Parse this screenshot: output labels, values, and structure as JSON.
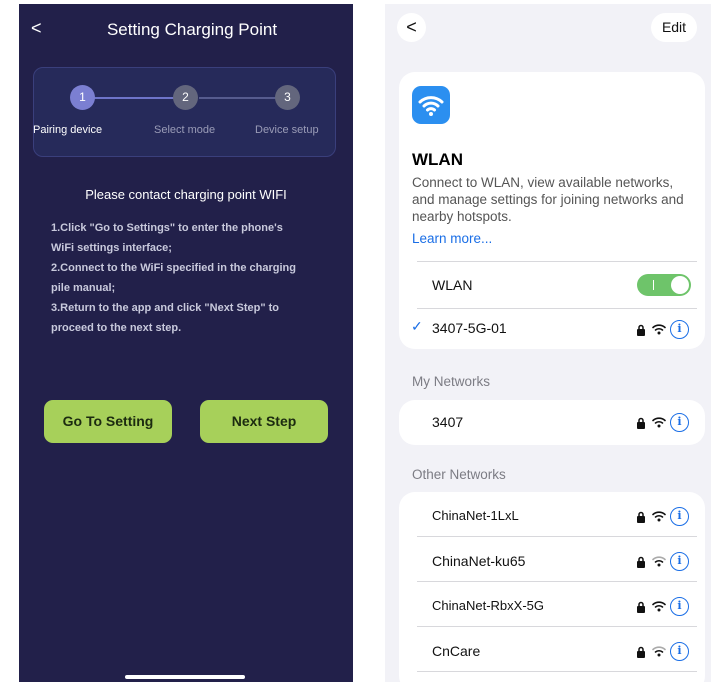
{
  "left": {
    "back_glyph": "<",
    "title": "Setting Charging Point",
    "steps": [
      {
        "number": "1",
        "label": "Pairing device"
      },
      {
        "number": "2",
        "label": "Select mode"
      },
      {
        "number": "3",
        "label": "Device setup"
      }
    ],
    "heading": "Please contact charging point WIFI",
    "instructions": [
      "1.Click \"Go to Settings\" to enter the phone's",
      "WiFi settings interface;",
      "2.Connect to the WiFi specified in the charging",
      "pile manual;",
      "3.Return to the app and click \"Next Step\" to",
      "proceed to the next step."
    ],
    "go_to_setting_label": "Go To Setting",
    "next_step_label": "Next Step",
    "colors": {
      "background": "#22204a",
      "button": "#a7d05a",
      "step_active": "#7b7fd2"
    }
  },
  "right": {
    "back_glyph": "<",
    "edit_label": "Edit",
    "wlan_icon": "wifi-app-icon",
    "wlan_title": "WLAN",
    "wlan_desc": "Connect to WLAN, view available networks, and manage settings for joining networks and nearby hotspots.",
    "learn_more": "Learn more...",
    "wlan_toggle_label": "WLAN",
    "wlan_toggle_on": true,
    "check_glyph": "✓",
    "connected_network": "3407-5G-01",
    "my_networks_title": "My Networks",
    "my_networks": [
      "3407"
    ],
    "other_networks_title": "Other Networks",
    "other_networks": [
      "ChinaNet-1LxL",
      "ChinaNet-ku65",
      "ChinaNet-RbxX-5G",
      "CnCare"
    ],
    "info_glyph": "i",
    "colors": {
      "accent": "#1a6ee6",
      "toggle_on": "#6ec46a",
      "background": "#f2f2f7"
    }
  }
}
